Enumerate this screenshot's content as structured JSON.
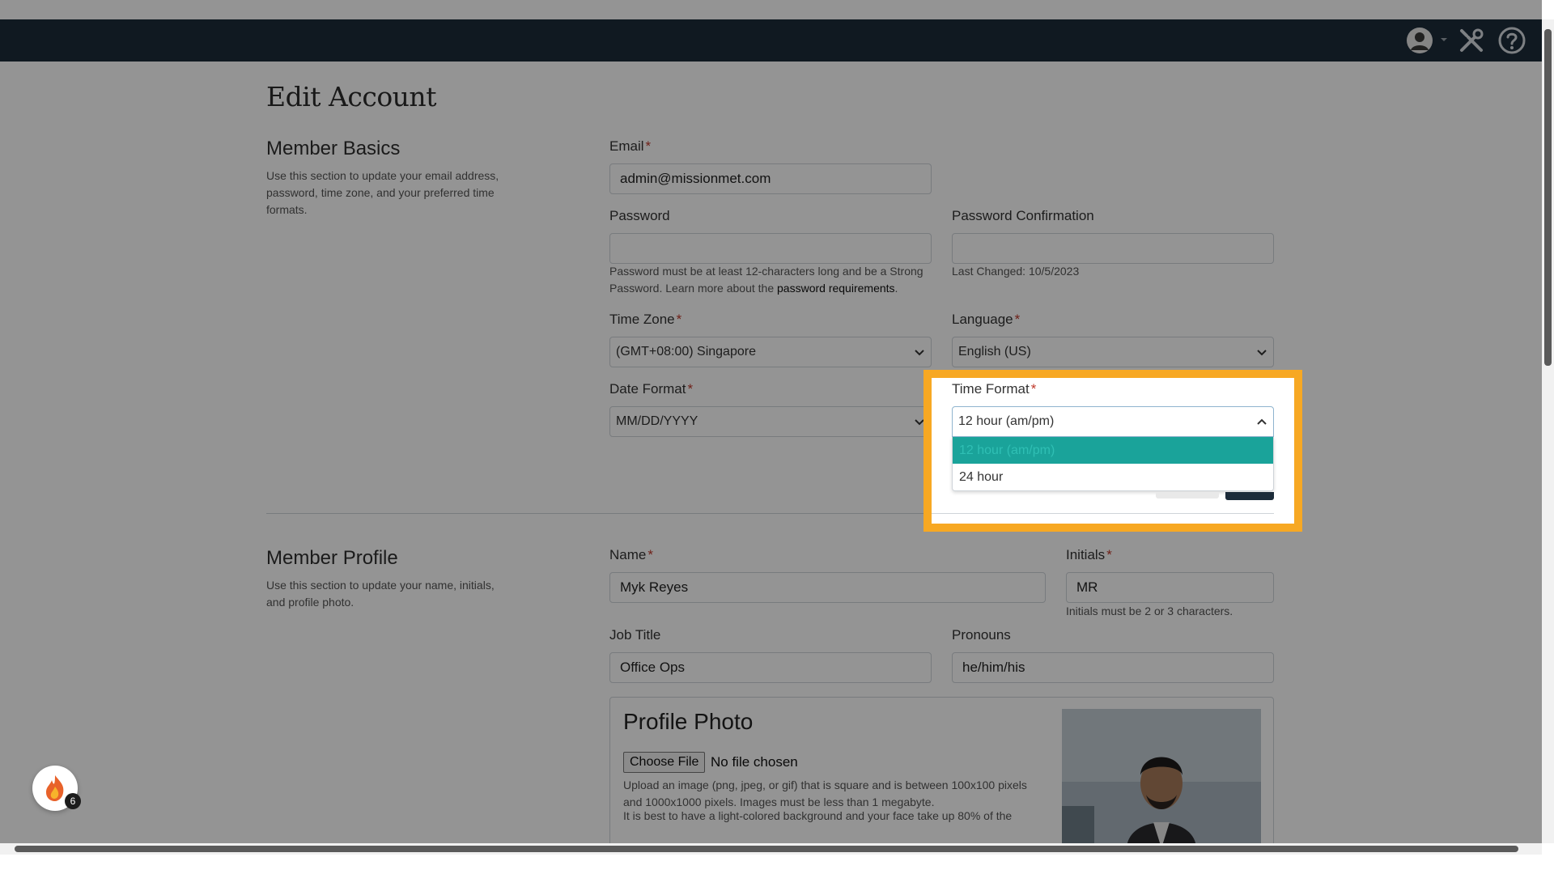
{
  "page": {
    "title": "Edit Account"
  },
  "member_basics": {
    "title": "Member Basics",
    "description": "Use this section to update your email address, password, time zone, and your preferred time formats.",
    "email": {
      "label": "Email",
      "value": "admin@missionmet.com"
    },
    "password": {
      "label": "Password",
      "value": "",
      "hint_prefix": "Password must be at least 12-characters long and be a Strong Password. Learn more about the ",
      "hint_link": "password requirements",
      "hint_suffix": "."
    },
    "password_confirmation": {
      "label": "Password Confirmation",
      "value": "",
      "last_changed": "Last Changed: 10/5/2023"
    },
    "time_zone": {
      "label": "Time Zone",
      "value": "(GMT+08:00) Singapore"
    },
    "language": {
      "label": "Language",
      "value": "English (US)"
    },
    "date_format": {
      "label": "Date Format",
      "value": "MM/DD/YYYY"
    },
    "time_format": {
      "label": "Time Format",
      "value": "12 hour (am/pm)",
      "options": [
        "12 hour (am/pm)",
        "24 hour"
      ],
      "selected_index": 0
    }
  },
  "member_profile": {
    "title": "Member Profile",
    "description": "Use this section to update your name, initials, and profile photo.",
    "name": {
      "label": "Name",
      "value": "Myk Reyes"
    },
    "initials": {
      "label": "Initials",
      "value": "MR",
      "hint": "Initials must be 2 or 3 characters."
    },
    "job_title": {
      "label": "Job Title",
      "value": "Office Ops"
    },
    "pronouns": {
      "label": "Pronouns",
      "value": "he/him/his"
    },
    "profile_photo": {
      "title": "Profile Photo",
      "choose_file": "Choose File",
      "no_file": "No file chosen",
      "hint1": "Upload an image (png, jpeg, or gif) that is square and is between 100x100 pixels and 1000x1000 pixels. Images must be less than 1 megabyte.",
      "hint2": "It is best to have a light-colored background and your face take up 80% of the"
    }
  },
  "widget": {
    "badge_count": "6"
  },
  "icons": [
    "user-avatar-icon",
    "caret-down-icon",
    "tools-icon",
    "help-icon",
    "chevron-down-icon",
    "chevron-up-icon",
    "flame-icon"
  ],
  "colors": {
    "navbar": "#1c2b39",
    "highlight": "#f7a823",
    "selected_option": "#1aa39a",
    "required": "#c0392b"
  }
}
